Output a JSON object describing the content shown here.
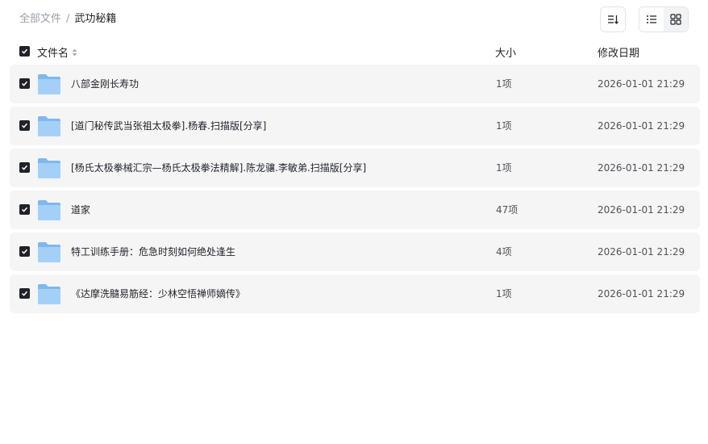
{
  "breadcrumb": {
    "root": "全部文件",
    "separator": "/",
    "current": "武功秘籍"
  },
  "toolbar": {
    "sort_icon": "sort-icon",
    "list_view_icon": "list-view-icon",
    "grid_view_icon": "grid-view-icon"
  },
  "table": {
    "headers": {
      "name": "文件名",
      "size": "大小",
      "date": "修改日期"
    },
    "rows": [
      {
        "name": "八部金刚长寿功",
        "size": "1项",
        "date": "2026-01-01 21:29",
        "checked": true
      },
      {
        "name": "[道门秘传武当张祖太极拳].杨春.扫描版[分享]",
        "size": "1项",
        "date": "2026-01-01 21:29",
        "checked": true
      },
      {
        "name": "[杨氏太极拳械汇宗—杨氏太极拳法精解].陈龙骧.李敏弟.扫描版[分享]",
        "size": "1项",
        "date": "2026-01-01 21:29",
        "checked": true
      },
      {
        "name": "道家",
        "size": "47项",
        "date": "2026-01-01 21:29",
        "checked": true
      },
      {
        "name": "特工训练手册：危急时刻如何绝处逢生",
        "size": "4项",
        "date": "2026-01-01 21:29",
        "checked": true
      },
      {
        "name": "《达摩洗髓易筋经：少林空悟禅师嫡传》",
        "size": "1项",
        "date": "2026-01-01 21:29",
        "checked": true
      }
    ]
  },
  "colors": {
    "row_bg": "#f5f5f6",
    "folder_blue": "#8cc4f5",
    "checkbox": "#1f2329",
    "text_muted": "#9aa0a8"
  }
}
